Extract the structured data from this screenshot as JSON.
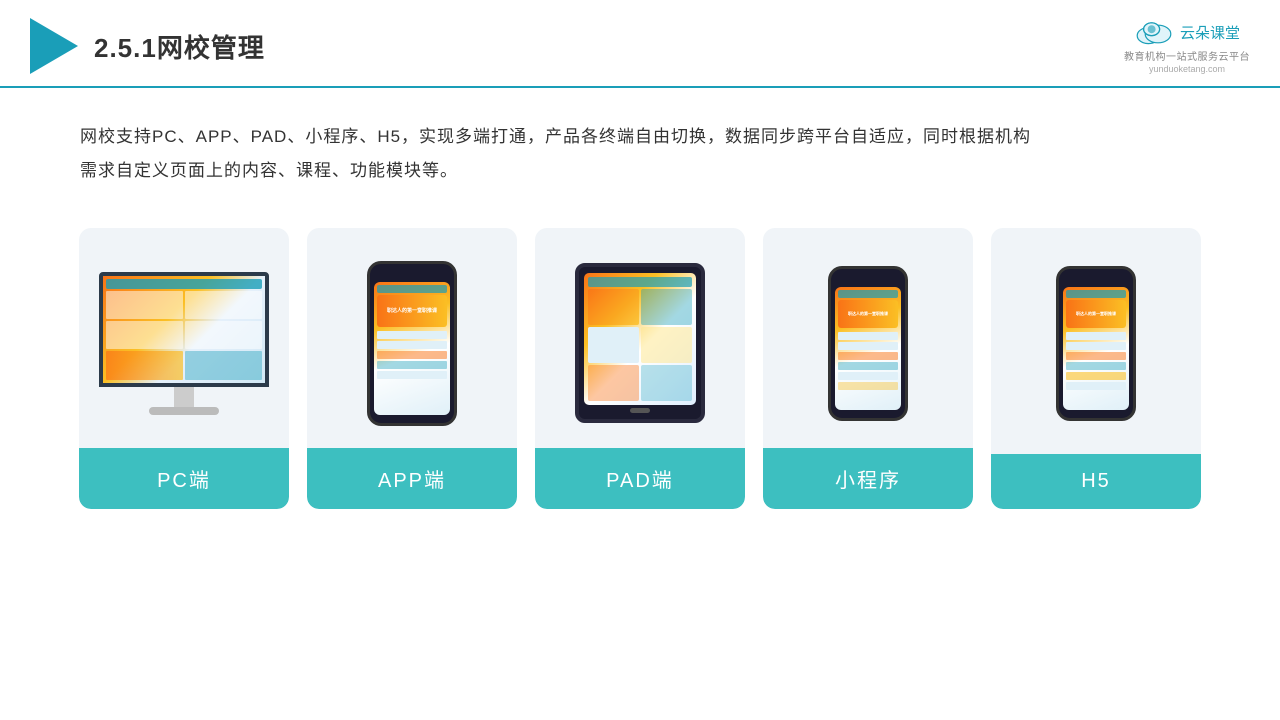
{
  "header": {
    "title": "2.5.1网校管理",
    "brand_name": "云朵课堂",
    "brand_sub": "教育机构一站式服务云平台",
    "brand_url": "yunduoketang.com"
  },
  "description": {
    "text1": "网校支持PC、APP、PAD、小程序、H5，实现多端打通，产品各终端自由切换，数据同步跨平台自适应，同时根据机构",
    "text2": "需求自定义页面上的内容、课程、功能模块等。"
  },
  "cards": [
    {
      "id": "pc",
      "label": "PC端"
    },
    {
      "id": "app",
      "label": "APP端"
    },
    {
      "id": "pad",
      "label": "PAD端"
    },
    {
      "id": "miniprogram",
      "label": "小程序"
    },
    {
      "id": "h5",
      "label": "H5"
    }
  ],
  "colors": {
    "teal": "#3dbfc0",
    "accent": "#1a9eb8",
    "bg_card": "#f0f4f8"
  }
}
